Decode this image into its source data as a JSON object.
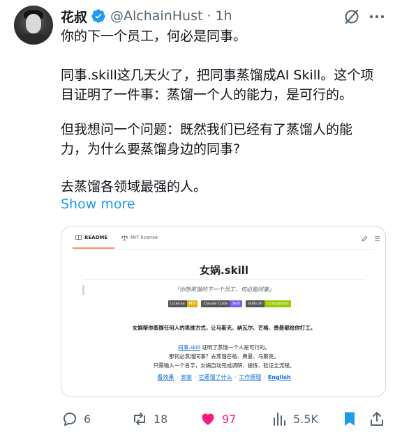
{
  "post": {
    "author_name": "花叔",
    "handle": "@AlchainHust",
    "time_sep": "·",
    "time": "1h",
    "lines": [
      "你的下一个员工，何必是同事。",
      "同事.skill这几天火了，把同事蒸馏成AI Skill。这个项",
      "目证明了一件事：蒸馏一个人的能力，是可行的。",
      "但我想问一个问题：既然我们已经有了蒸馏人的能",
      "力，为什么要蒸馏身边的同事?",
      "去蒸馏各领域最强的人。"
    ],
    "show_more": "Show more"
  },
  "card": {
    "tab_readme": "README",
    "tab_license": "MIT license",
    "title": "女娲.skill",
    "quote": "「你想蒸馏的下一个员工，何必是同事」",
    "badges": [
      {
        "label": "License",
        "value": "MIT",
        "color": "#dfb317"
      },
      {
        "label": "Claude Code",
        "value": "Skill",
        "color": "#7b5cff"
      },
      {
        "label": "skills.sh",
        "value": "Compatible",
        "color": "#97ca00"
      }
    ],
    "description": "女娲帮你蒸馏任何人的思维方式，让马斯克、纳瓦尔、芒格、费曼都给你打工。",
    "line1_link": "同事.skill",
    "line1_rest": " 证明了蒸馏一个人是可行的。",
    "line2": "那何必蒸馏同事？去蒸馏芒格、费曼、马斯克。",
    "line3": "只需输入一个名字，女娲自动完成调研、提炼、验证全流程。",
    "links": [
      "看效果",
      "安装",
      "它蒸馏了什么",
      "工作原理",
      "English"
    ],
    "link_sep": "·"
  },
  "actions": {
    "replies": "6",
    "reposts": "18",
    "likes": "97",
    "views": "5.5K"
  },
  "colors": {
    "like": "#f91880",
    "bookmark": "#1d9bf0",
    "verified": "#1d9bf0",
    "link": "#1d9bf0"
  },
  "icons": [
    "verified-badge-icon",
    "grok-icon",
    "more-icon",
    "book-icon",
    "scale-icon",
    "pencil-icon",
    "list-icon",
    "reply-icon",
    "repost-icon",
    "like-icon",
    "views-icon",
    "bookmark-icon",
    "share-icon"
  ]
}
